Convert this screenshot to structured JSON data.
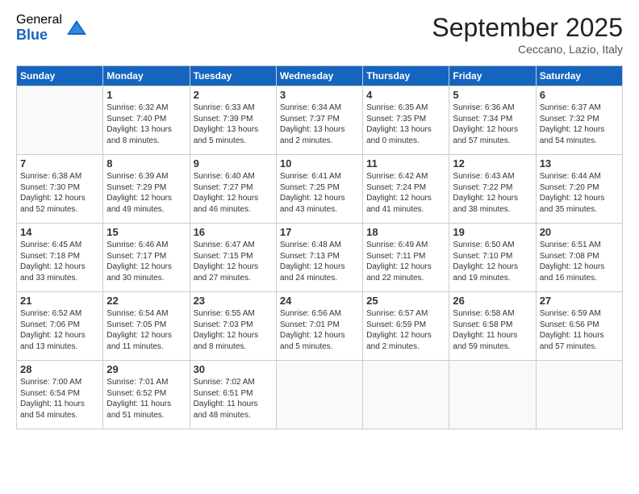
{
  "logo": {
    "general": "General",
    "blue": "Blue"
  },
  "title": "September 2025",
  "location": "Ceccano, Lazio, Italy",
  "days_of_week": [
    "Sunday",
    "Monday",
    "Tuesday",
    "Wednesday",
    "Thursday",
    "Friday",
    "Saturday"
  ],
  "weeks": [
    [
      {
        "day": "",
        "info": ""
      },
      {
        "day": "1",
        "sunrise": "Sunrise: 6:32 AM",
        "sunset": "Sunset: 7:40 PM",
        "daylight": "Daylight: 13 hours and 8 minutes."
      },
      {
        "day": "2",
        "sunrise": "Sunrise: 6:33 AM",
        "sunset": "Sunset: 7:39 PM",
        "daylight": "Daylight: 13 hours and 5 minutes."
      },
      {
        "day": "3",
        "sunrise": "Sunrise: 6:34 AM",
        "sunset": "Sunset: 7:37 PM",
        "daylight": "Daylight: 13 hours and 2 minutes."
      },
      {
        "day": "4",
        "sunrise": "Sunrise: 6:35 AM",
        "sunset": "Sunset: 7:35 PM",
        "daylight": "Daylight: 13 hours and 0 minutes."
      },
      {
        "day": "5",
        "sunrise": "Sunrise: 6:36 AM",
        "sunset": "Sunset: 7:34 PM",
        "daylight": "Daylight: 12 hours and 57 minutes."
      },
      {
        "day": "6",
        "sunrise": "Sunrise: 6:37 AM",
        "sunset": "Sunset: 7:32 PM",
        "daylight": "Daylight: 12 hours and 54 minutes."
      }
    ],
    [
      {
        "day": "7",
        "sunrise": "Sunrise: 6:38 AM",
        "sunset": "Sunset: 7:30 PM",
        "daylight": "Daylight: 12 hours and 52 minutes."
      },
      {
        "day": "8",
        "sunrise": "Sunrise: 6:39 AM",
        "sunset": "Sunset: 7:29 PM",
        "daylight": "Daylight: 12 hours and 49 minutes."
      },
      {
        "day": "9",
        "sunrise": "Sunrise: 6:40 AM",
        "sunset": "Sunset: 7:27 PM",
        "daylight": "Daylight: 12 hours and 46 minutes."
      },
      {
        "day": "10",
        "sunrise": "Sunrise: 6:41 AM",
        "sunset": "Sunset: 7:25 PM",
        "daylight": "Daylight: 12 hours and 43 minutes."
      },
      {
        "day": "11",
        "sunrise": "Sunrise: 6:42 AM",
        "sunset": "Sunset: 7:24 PM",
        "daylight": "Daylight: 12 hours and 41 minutes."
      },
      {
        "day": "12",
        "sunrise": "Sunrise: 6:43 AM",
        "sunset": "Sunset: 7:22 PM",
        "daylight": "Daylight: 12 hours and 38 minutes."
      },
      {
        "day": "13",
        "sunrise": "Sunrise: 6:44 AM",
        "sunset": "Sunset: 7:20 PM",
        "daylight": "Daylight: 12 hours and 35 minutes."
      }
    ],
    [
      {
        "day": "14",
        "sunrise": "Sunrise: 6:45 AM",
        "sunset": "Sunset: 7:18 PM",
        "daylight": "Daylight: 12 hours and 33 minutes."
      },
      {
        "day": "15",
        "sunrise": "Sunrise: 6:46 AM",
        "sunset": "Sunset: 7:17 PM",
        "daylight": "Daylight: 12 hours and 30 minutes."
      },
      {
        "day": "16",
        "sunrise": "Sunrise: 6:47 AM",
        "sunset": "Sunset: 7:15 PM",
        "daylight": "Daylight: 12 hours and 27 minutes."
      },
      {
        "day": "17",
        "sunrise": "Sunrise: 6:48 AM",
        "sunset": "Sunset: 7:13 PM",
        "daylight": "Daylight: 12 hours and 24 minutes."
      },
      {
        "day": "18",
        "sunrise": "Sunrise: 6:49 AM",
        "sunset": "Sunset: 7:11 PM",
        "daylight": "Daylight: 12 hours and 22 minutes."
      },
      {
        "day": "19",
        "sunrise": "Sunrise: 6:50 AM",
        "sunset": "Sunset: 7:10 PM",
        "daylight": "Daylight: 12 hours and 19 minutes."
      },
      {
        "day": "20",
        "sunrise": "Sunrise: 6:51 AM",
        "sunset": "Sunset: 7:08 PM",
        "daylight": "Daylight: 12 hours and 16 minutes."
      }
    ],
    [
      {
        "day": "21",
        "sunrise": "Sunrise: 6:52 AM",
        "sunset": "Sunset: 7:06 PM",
        "daylight": "Daylight: 12 hours and 13 minutes."
      },
      {
        "day": "22",
        "sunrise": "Sunrise: 6:54 AM",
        "sunset": "Sunset: 7:05 PM",
        "daylight": "Daylight: 12 hours and 11 minutes."
      },
      {
        "day": "23",
        "sunrise": "Sunrise: 6:55 AM",
        "sunset": "Sunset: 7:03 PM",
        "daylight": "Daylight: 12 hours and 8 minutes."
      },
      {
        "day": "24",
        "sunrise": "Sunrise: 6:56 AM",
        "sunset": "Sunset: 7:01 PM",
        "daylight": "Daylight: 12 hours and 5 minutes."
      },
      {
        "day": "25",
        "sunrise": "Sunrise: 6:57 AM",
        "sunset": "Sunset: 6:59 PM",
        "daylight": "Daylight: 12 hours and 2 minutes."
      },
      {
        "day": "26",
        "sunrise": "Sunrise: 6:58 AM",
        "sunset": "Sunset: 6:58 PM",
        "daylight": "Daylight: 11 hours and 59 minutes."
      },
      {
        "day": "27",
        "sunrise": "Sunrise: 6:59 AM",
        "sunset": "Sunset: 6:56 PM",
        "daylight": "Daylight: 11 hours and 57 minutes."
      }
    ],
    [
      {
        "day": "28",
        "sunrise": "Sunrise: 7:00 AM",
        "sunset": "Sunset: 6:54 PM",
        "daylight": "Daylight: 11 hours and 54 minutes."
      },
      {
        "day": "29",
        "sunrise": "Sunrise: 7:01 AM",
        "sunset": "Sunset: 6:52 PM",
        "daylight": "Daylight: 11 hours and 51 minutes."
      },
      {
        "day": "30",
        "sunrise": "Sunrise: 7:02 AM",
        "sunset": "Sunset: 6:51 PM",
        "daylight": "Daylight: 11 hours and 48 minutes."
      },
      {
        "day": "",
        "info": ""
      },
      {
        "day": "",
        "info": ""
      },
      {
        "day": "",
        "info": ""
      },
      {
        "day": "",
        "info": ""
      }
    ]
  ]
}
